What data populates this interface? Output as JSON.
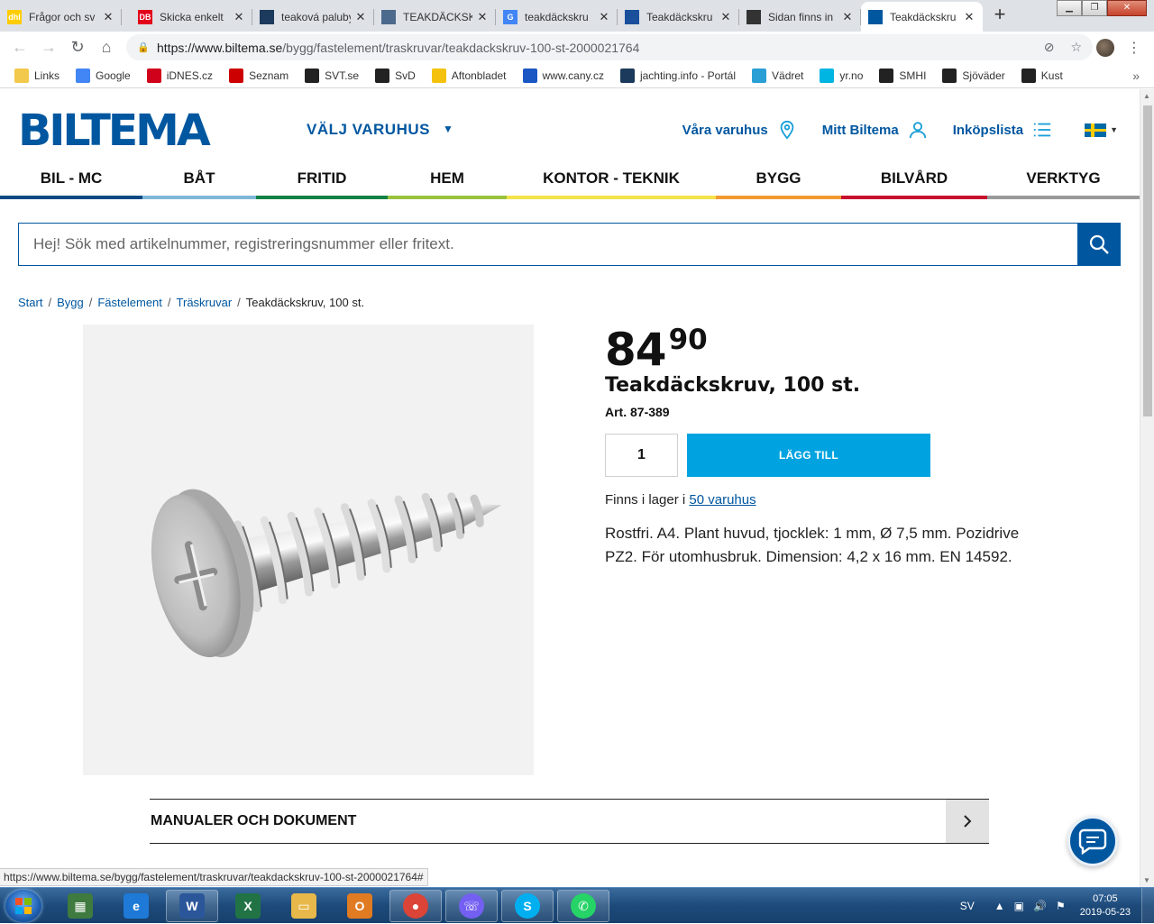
{
  "browser": {
    "tabs": [
      {
        "title": "Frågor och sv",
        "fav_text": "dhl",
        "fav_color": "#ffcc00"
      },
      {
        "title": "Skicka enkelt",
        "fav_text": "DB",
        "fav_color": "#e2001a"
      },
      {
        "title": "teaková paluby",
        "fav_text": "",
        "fav_color": "#1b3a5c"
      },
      {
        "title": "TEAKDÄCKSK",
        "fav_text": "",
        "fav_color": "#4b6a8c"
      },
      {
        "title": "teakdäckskru",
        "fav_text": "G",
        "fav_color": "#4285f4"
      },
      {
        "title": "Teakdäckskru",
        "fav_text": "",
        "fav_color": "#1a4f9c"
      },
      {
        "title": "Sidan finns in",
        "fav_text": "",
        "fav_color": "#333333"
      },
      {
        "title": "Teakdäckskru",
        "fav_text": "",
        "fav_color": "#0057a0"
      }
    ],
    "url_host": "https://www.biltema.se",
    "url_path": "/bygg/fastelement/traskruvar/teakdackskruv-100-st-2000021764",
    "bookmarks": [
      {
        "label": "Links",
        "color": "#f2c94c"
      },
      {
        "label": "Google",
        "color": "#4285f4"
      },
      {
        "label": "iDNES.cz",
        "color": "#d0021b"
      },
      {
        "label": "Seznam",
        "color": "#cc0000"
      },
      {
        "label": "SVT.se",
        "color": "#222222"
      },
      {
        "label": "SvD",
        "color": "#222222"
      },
      {
        "label": "Aftonbladet",
        "color": "#f4c20d"
      },
      {
        "label": "www.cany.cz",
        "color": "#1a56c4"
      },
      {
        "label": "jachting.info - Portál",
        "color": "#1b3a5c"
      },
      {
        "label": "Vädret",
        "color": "#2a9fd6"
      },
      {
        "label": "yr.no",
        "color": "#00b5e2"
      },
      {
        "label": "SMHI",
        "color": "#222222"
      },
      {
        "label": "Sjöväder",
        "color": "#222222"
      },
      {
        "label": "Kust",
        "color": "#222222"
      }
    ],
    "status_url": "https://www.biltema.se/bygg/fastelement/traskruvar/teakdackskruv-100-st-2000021764#"
  },
  "site": {
    "logo": "BILTEMA",
    "store_select": "VÄLJ VARUHUS",
    "top_links": {
      "stores": "Våra varuhus",
      "account": "Mitt Biltema",
      "list": "Inköpslista"
    },
    "categories": [
      {
        "label": "BIL - MC",
        "color": "#0c4a83",
        "width": 158
      },
      {
        "label": "BÅT",
        "color": "#7fb6d9",
        "width": 126
      },
      {
        "label": "FRITID",
        "color": "#138244",
        "width": 146
      },
      {
        "label": "HEM",
        "color": "#99c23c",
        "width": 132
      },
      {
        "label": "KONTOR - TEKNIK",
        "color": "#f5e34a",
        "width": 232
      },
      {
        "label": "BYGG",
        "color": "#f29a32",
        "width": 139
      },
      {
        "label": "BILVÅRD",
        "color": "#c8102e",
        "width": 162
      },
      {
        "label": "VERKTYG",
        "color": "#9a9a9a",
        "width": 169
      }
    ],
    "search_placeholder": "Hej! Sök med artikelnummer, registreringsnummer eller fritext."
  },
  "breadcrumb": [
    "Start",
    "Bygg",
    "Fästelement",
    "Träskruvar",
    "Teakdäckskruv, 100 st."
  ],
  "product": {
    "price_int": "84",
    "price_dec": "90",
    "title": "Teakdäckskruv, 100 st.",
    "art_nr": "Art. 87-389",
    "quantity": "1",
    "add_button": "LÄGG TILL",
    "stock_prefix": "Finns i lager i",
    "stock_link": "50 varuhus",
    "description": "Rostfri. A4. Plant huvud, tjocklek: 1 mm, Ø 7,5 mm. Pozidrive PZ2. För utomhusbruk. Dimension: 4,2 x 16 mm. EN 14592."
  },
  "sections": {
    "manuals": "MANUALER OCH DOKUMENT"
  },
  "taskbar": {
    "language": "SV",
    "time": "07:05",
    "date": "2019-05-23",
    "apps": [
      {
        "name": "file-manager",
        "glyph": "▦",
        "color": "#3f7a3f",
        "running": false
      },
      {
        "name": "internet-explorer",
        "glyph": "e",
        "color": "#1e7ad6",
        "running": false
      },
      {
        "name": "word",
        "glyph": "W",
        "color": "#2b579a",
        "running": true
      },
      {
        "name": "excel",
        "glyph": "X",
        "color": "#217346",
        "running": false
      },
      {
        "name": "explorer",
        "glyph": "▭",
        "color": "#e8b84a",
        "running": false
      },
      {
        "name": "outlook",
        "glyph": "O",
        "color": "#e07b22",
        "running": false
      },
      {
        "name": "chrome",
        "glyph": "●",
        "color": "#db4437",
        "running": true
      },
      {
        "name": "viber",
        "glyph": "☏",
        "color": "#7360f2",
        "running": true
      },
      {
        "name": "skype",
        "glyph": "S",
        "color": "#00aff0",
        "running": true
      },
      {
        "name": "whatsapp",
        "glyph": "✆",
        "color": "#25d366",
        "running": true
      }
    ]
  }
}
